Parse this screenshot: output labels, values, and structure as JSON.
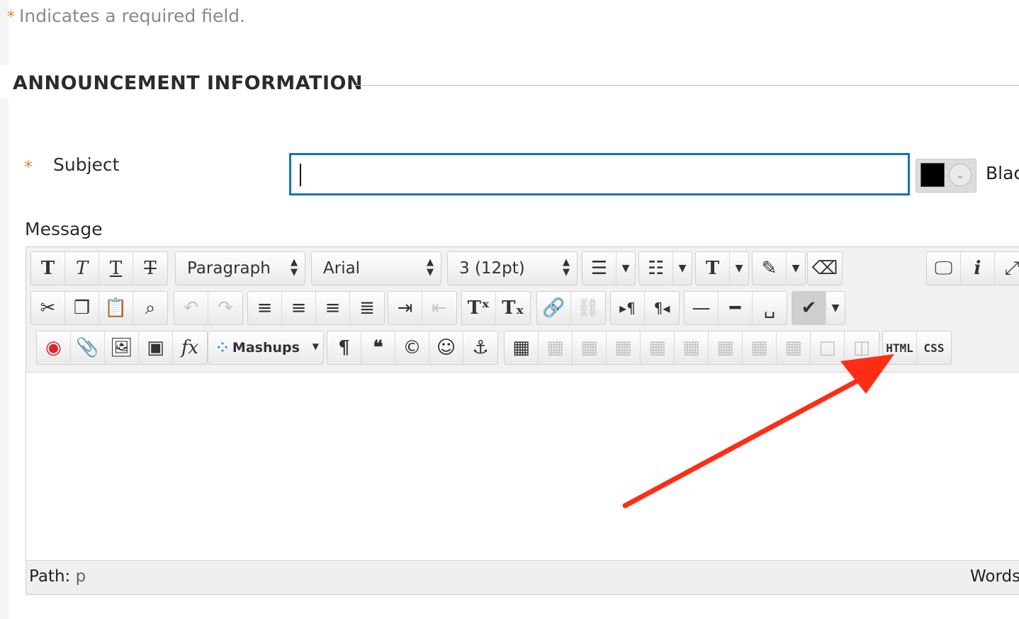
{
  "required_note": {
    "star": "*",
    "text": "Indicates a required field."
  },
  "section": {
    "title": "ANNOUNCEMENT INFORMATION"
  },
  "subject": {
    "star": "*",
    "label": "Subject",
    "value": ""
  },
  "color_picker": {
    "swatch_color": "#000000",
    "label": "Blac"
  },
  "message": {
    "label": "Message"
  },
  "toolbar": {
    "row1": {
      "format_select": "Paragraph",
      "font_select": "Arial",
      "size_select": "3 (12pt)"
    },
    "row3": {
      "mashups": "Mashups",
      "html_button": "HTML",
      "css_button": "CSS"
    }
  },
  "status_bar": {
    "path_label": "Path:",
    "path_value": "p",
    "words_label": "Words"
  },
  "colors": {
    "accent": "#1b6fc2",
    "required": "#e8861f",
    "arrow": "#ff2d14"
  }
}
